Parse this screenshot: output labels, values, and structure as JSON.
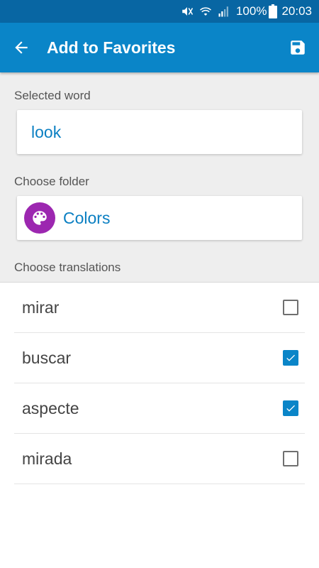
{
  "status_bar": {
    "battery": "100%",
    "time": "20:03"
  },
  "app_bar": {
    "title": "Add to Favorites"
  },
  "selected_word": {
    "label": "Selected word",
    "value": "look"
  },
  "folder": {
    "label": "Choose folder",
    "name": "Colors",
    "icon": "palette-icon",
    "icon_color": "#9c27b0"
  },
  "translations": {
    "label": "Choose translations",
    "items": [
      {
        "text": "mirar",
        "checked": false
      },
      {
        "text": "buscar",
        "checked": true
      },
      {
        "text": "aspecte",
        "checked": true
      },
      {
        "text": "mirada",
        "checked": false
      }
    ]
  },
  "colors": {
    "status_bar": "#0866a3",
    "app_bar": "#0a85c8",
    "accent": "#0a7fc2"
  }
}
